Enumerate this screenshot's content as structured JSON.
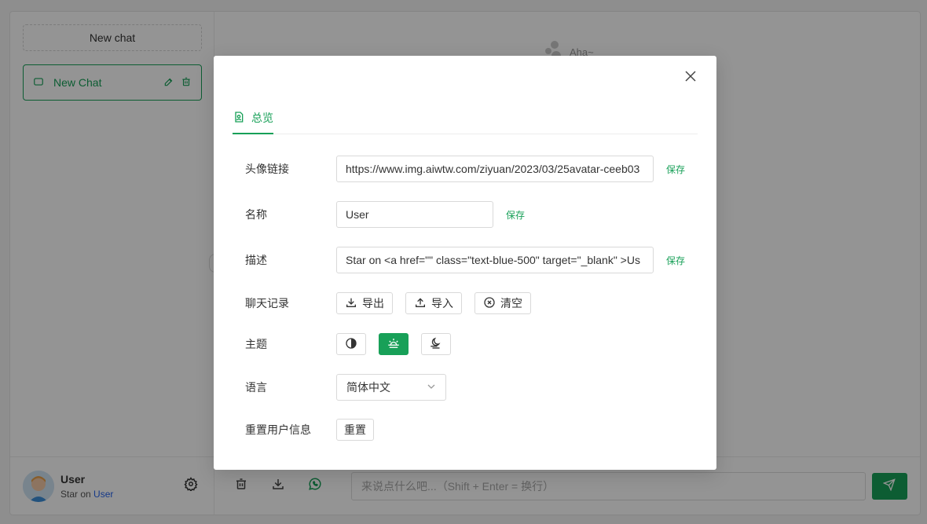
{
  "sidebar": {
    "new_chat_label": "New chat",
    "chats": [
      {
        "title": "New Chat"
      }
    ],
    "user": {
      "name": "User",
      "desc_prefix": "Star on",
      "desc_link": "User"
    }
  },
  "main": {
    "placeholder_brand": "Aha~",
    "input_placeholder": "来说点什么吧...（Shift + Enter = 换行）"
  },
  "modal": {
    "tab_overview": "总览",
    "avatar": {
      "label": "头像链接",
      "value": "https://www.img.aiwtw.com/ziyuan/2023/03/25avatar-ceeb03",
      "save": "保存"
    },
    "name": {
      "label": "名称",
      "value": "User",
      "save": "保存"
    },
    "description": {
      "label": "描述",
      "value": "Star on <a href=\"\" class=\"text-blue-500\" target=\"_blank\" >Us",
      "save": "保存"
    },
    "chat_history": {
      "label": "聊天记录",
      "export": "导出",
      "import": "导入",
      "clear": "清空"
    },
    "theme": {
      "label": "主题",
      "options": [
        "auto",
        "light",
        "dark"
      ],
      "selected": "light"
    },
    "language": {
      "label": "语言",
      "value": "简体中文"
    },
    "reset": {
      "label": "重置用户信息",
      "button": "重置"
    }
  },
  "colors": {
    "accent": "#18a058",
    "link": "#2563eb"
  }
}
